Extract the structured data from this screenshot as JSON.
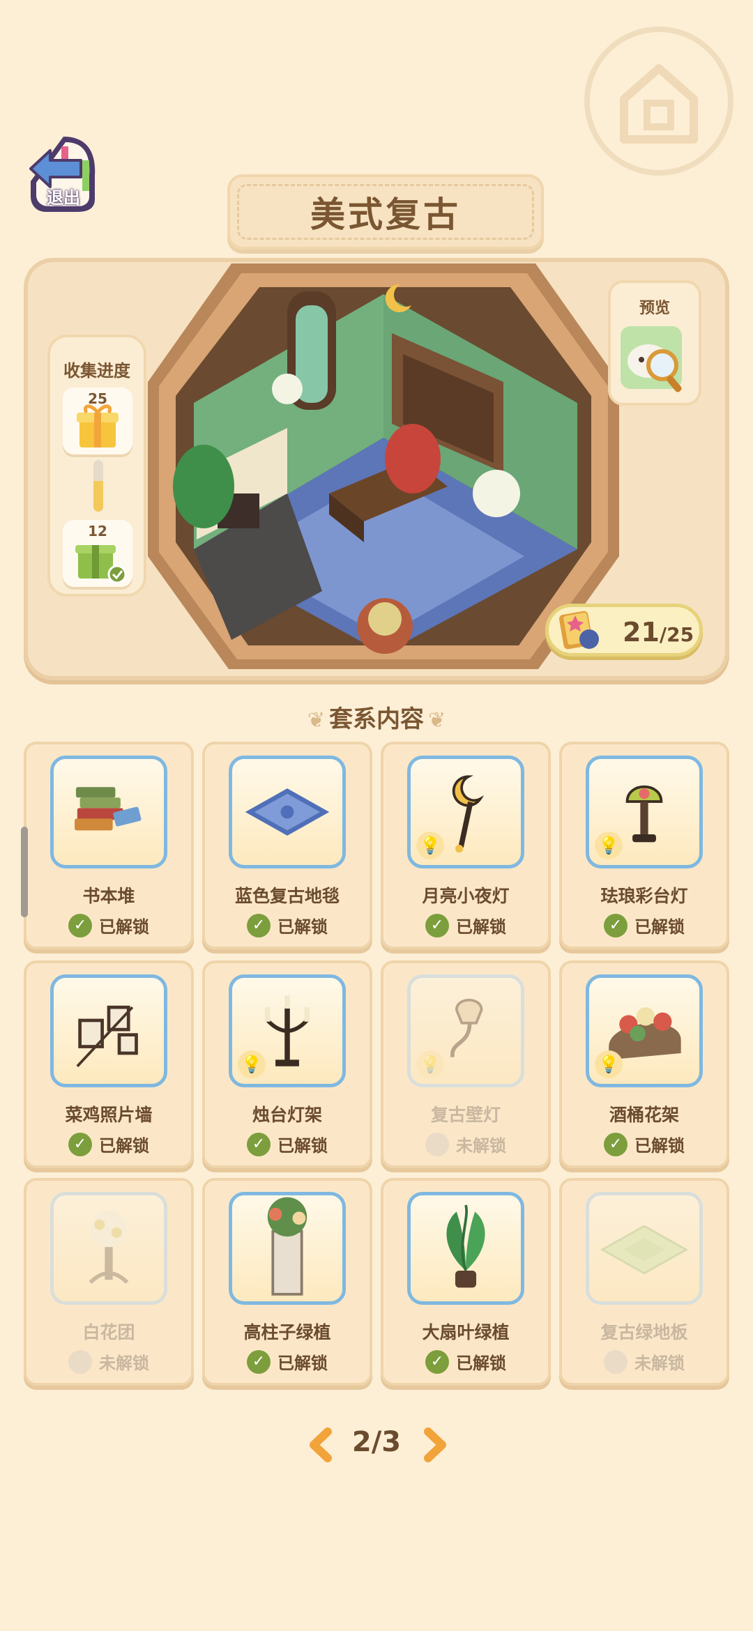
{
  "header": {
    "title": "美式复古",
    "exit_label": "退出"
  },
  "progress": {
    "title": "收集进度",
    "reward_top_count": "25",
    "reward_bottom_count": "12",
    "fill_fraction": 0.6
  },
  "preview": {
    "label": "预览"
  },
  "counter": {
    "collected": "21",
    "total": "/25"
  },
  "section": {
    "title": "套系内容"
  },
  "items": [
    {
      "name": "书本堆",
      "status": "已解锁",
      "unlocked": true,
      "bulb": false,
      "icon": "book-stack-icon"
    },
    {
      "name": "蓝色复古地毯",
      "status": "已解锁",
      "unlocked": true,
      "bulb": false,
      "icon": "blue-rug-icon"
    },
    {
      "name": "月亮小夜灯",
      "status": "已解锁",
      "unlocked": true,
      "bulb": true,
      "icon": "moon-lamp-icon"
    },
    {
      "name": "珐琅彩台灯",
      "status": "已解锁",
      "unlocked": true,
      "bulb": true,
      "icon": "enamel-lamp-icon"
    },
    {
      "name": "菜鸡照片墙",
      "status": "已解锁",
      "unlocked": true,
      "bulb": false,
      "icon": "photo-wall-icon"
    },
    {
      "name": "烛台灯架",
      "status": "已解锁",
      "unlocked": true,
      "bulb": true,
      "icon": "candelabra-icon"
    },
    {
      "name": "复古壁灯",
      "status": "未解锁",
      "unlocked": false,
      "bulb": true,
      "icon": "wall-sconce-icon"
    },
    {
      "name": "酒桶花架",
      "status": "已解锁",
      "unlocked": true,
      "bulb": true,
      "icon": "barrel-flower-stand-icon"
    },
    {
      "name": "白花团",
      "status": "未解锁",
      "unlocked": false,
      "bulb": false,
      "icon": "white-flowers-icon"
    },
    {
      "name": "高柱子绿植",
      "status": "已解锁",
      "unlocked": true,
      "bulb": false,
      "icon": "pillar-plant-icon"
    },
    {
      "name": "大扇叶绿植",
      "status": "已解锁",
      "unlocked": true,
      "bulb": false,
      "icon": "fan-leaf-plant-icon"
    },
    {
      "name": "复古绿地板",
      "status": "未解锁",
      "unlocked": false,
      "bulb": false,
      "icon": "green-floor-icon"
    }
  ],
  "pager": {
    "text": "2/3"
  },
  "colors": {
    "background": "#fdefd6",
    "unlocked_check": "#7c9e3c",
    "card_border_blue": "#7fb8e0",
    "locked_text": "#c9b7a0"
  }
}
